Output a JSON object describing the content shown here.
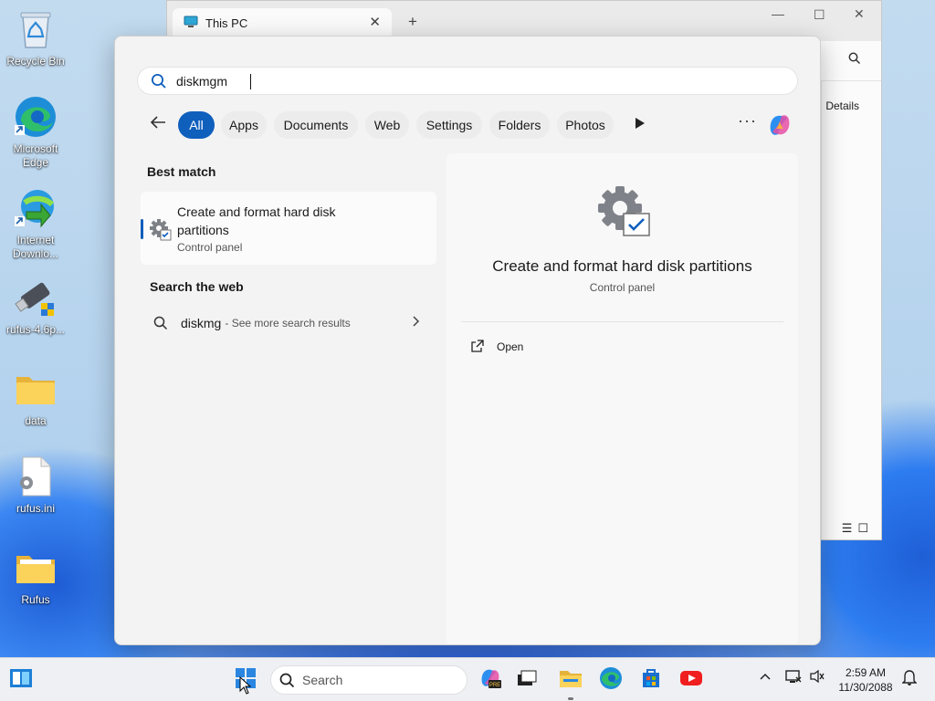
{
  "desktop": {
    "icons": [
      {
        "label": "Recycle Bin",
        "icon": "recycle-bin-icon"
      },
      {
        "label": "Microsoft Edge",
        "icon": "edge-icon"
      },
      {
        "label": "Internet Downlo...",
        "icon": "internet-download-manager-icon"
      },
      {
        "label": "rufus-4.6p...",
        "icon": "usb-drive-icon"
      },
      {
        "label": "data",
        "icon": "folder-icon"
      },
      {
        "label": "rufus.ini",
        "icon": "config-file-icon"
      },
      {
        "label": "Rufus",
        "icon": "folder-icon"
      }
    ]
  },
  "explorer": {
    "tab_title": "This PC",
    "details_label": "Details"
  },
  "search": {
    "query": "diskmgm",
    "filters": [
      "All",
      "Apps",
      "Documents",
      "Web",
      "Settings",
      "Folders",
      "Photos"
    ],
    "active_filter": "All",
    "best_match_heading": "Best match",
    "best_match": {
      "title": "Create and format hard disk partitions",
      "subtitle": "Control panel"
    },
    "web_heading": "Search the web",
    "web_result": {
      "query": "diskmg",
      "suffix": "- See more search results"
    },
    "preview": {
      "title": "Create and format hard disk partitions",
      "subtitle": "Control panel",
      "open_label": "Open"
    }
  },
  "taskbar": {
    "search_placeholder": "Search",
    "time": "2:59 AM",
    "date": "11/30/2088",
    "pinned": [
      "widgets-icon",
      "start-icon",
      "copilot-pre-icon",
      "task-view-icon",
      "file-explorer-icon",
      "edge-icon",
      "store-icon",
      "youtube-icon"
    ]
  },
  "colors": {
    "accent": "#0f5fbd",
    "taskbar_bg": "#eef0f4",
    "flyout_bg": "#f3f3f3"
  }
}
